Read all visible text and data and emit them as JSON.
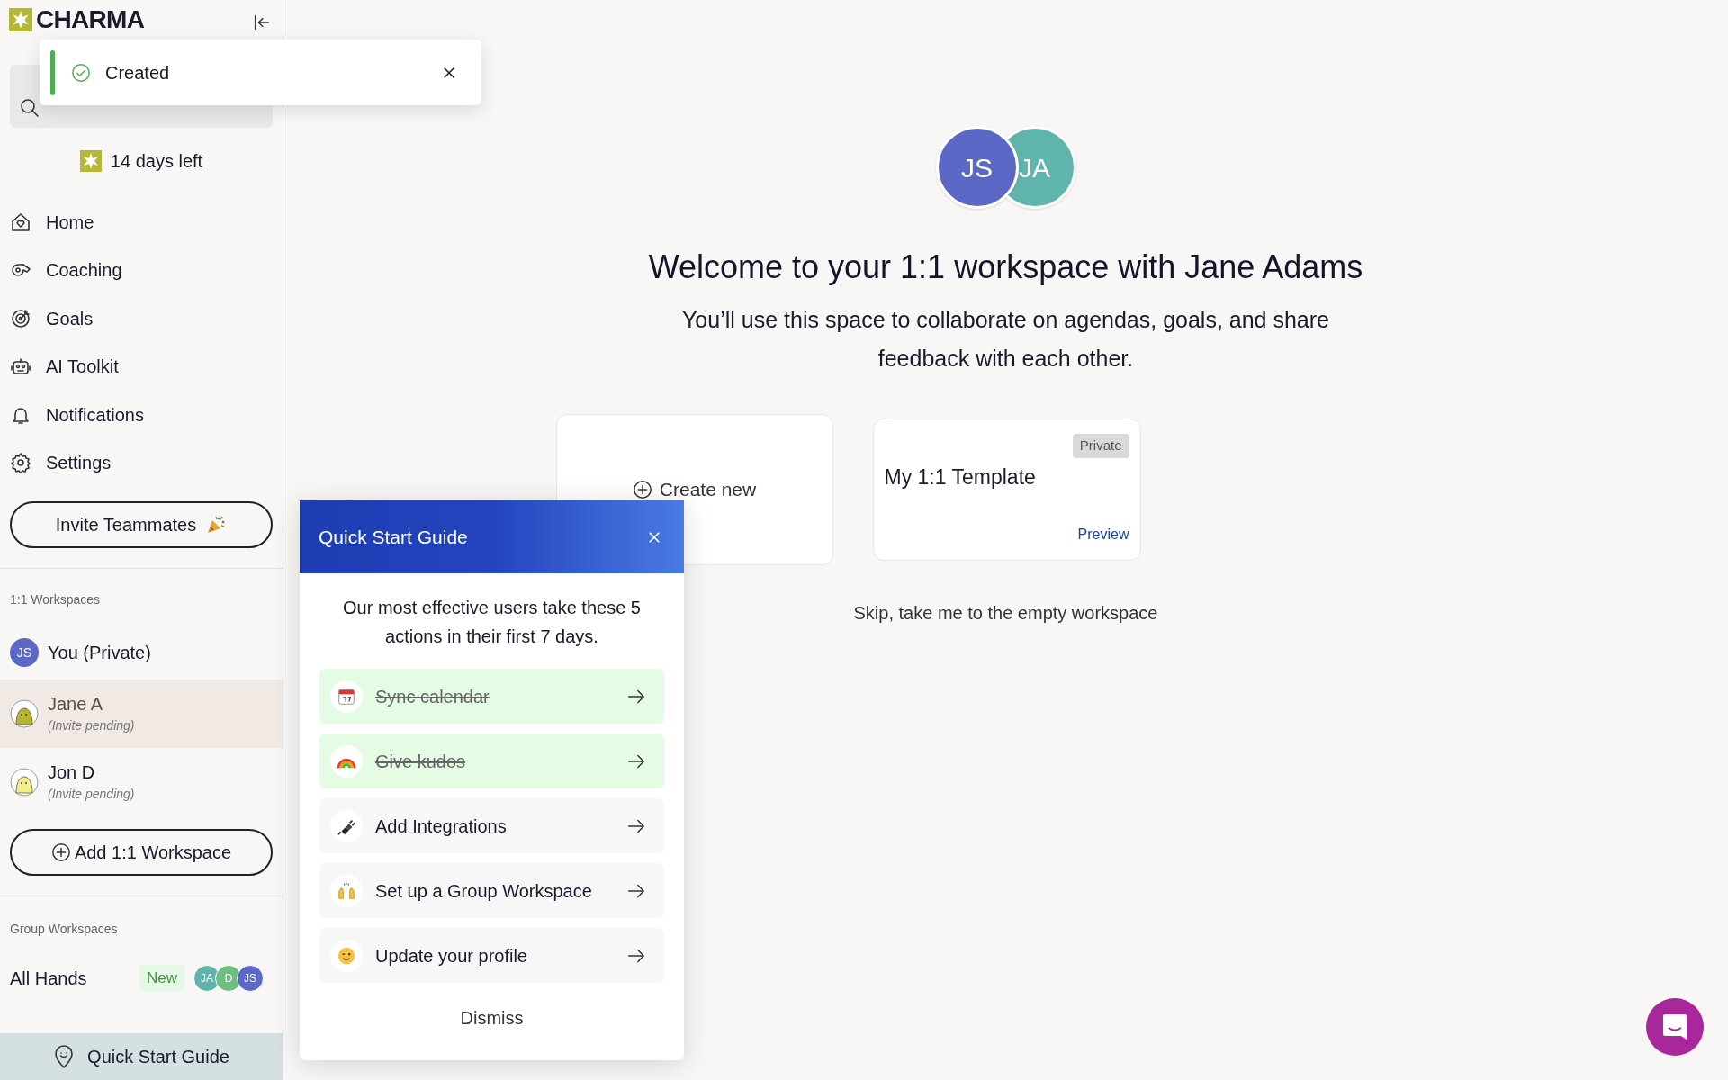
{
  "sidebar": {
    "logo": "CHARMA",
    "trial": "14 days left",
    "nav": [
      {
        "label": "Home"
      },
      {
        "label": "Coaching"
      },
      {
        "label": "Goals"
      },
      {
        "label": "AI Toolkit"
      },
      {
        "label": "Notifications"
      },
      {
        "label": "Settings"
      }
    ],
    "invite_button": "Invite Teammates",
    "one_on_one_heading": "1:1 Workspaces",
    "workspaces": [
      {
        "kind": "initials",
        "initials": "JS",
        "color": "#5c68c6",
        "name": "You (Private)",
        "selected": false
      },
      {
        "kind": "character",
        "color": "#b9b52a",
        "name": "Jane A",
        "note": "(Invite pending)",
        "selected": true
      },
      {
        "kind": "character",
        "color": "#f3ee8a",
        "name": "Jon D",
        "note": "(Invite pending)",
        "selected": false
      }
    ],
    "add_button": "Add 1:1 Workspace",
    "group_heading": "Group Workspaces",
    "groups": [
      {
        "name": "All Hands",
        "badge": "New",
        "members": [
          {
            "initials": "JA",
            "color": "#5fb4ab"
          },
          {
            "initials": "D",
            "color": "#6cbf7f"
          },
          {
            "initials": "JS",
            "color": "#5c68c6"
          }
        ]
      }
    ],
    "quick_start": "Quick Start Guide"
  },
  "toast": {
    "message": "Created"
  },
  "main": {
    "avatars": [
      {
        "initials": "JS",
        "color": "#5c68c6"
      },
      {
        "initials": "JA",
        "color": "#5fb4ab"
      }
    ],
    "title": "Welcome to your 1:1 workspace with Jane Adams",
    "subtitle": "You’ll use this space to collaborate on agendas, goals, and share feedback with each other.",
    "create_card": "Create new",
    "template_card": {
      "badge": "Private",
      "title": "My 1:1 Template",
      "link": "Preview"
    },
    "skip": "Skip, take me to the empty workspace"
  },
  "guide": {
    "title": "Quick Start Guide",
    "intro": "Our most effective users take these 5 actions in their first 7 days.",
    "steps": [
      {
        "label": "Sync calendar",
        "done": true
      },
      {
        "label": "Give kudos",
        "done": true
      },
      {
        "label": "Add Integrations",
        "done": false
      },
      {
        "label": "Set up a Group Workspace",
        "done": false
      },
      {
        "label": "Update your profile",
        "done": false
      }
    ],
    "dismiss": "Dismiss"
  }
}
